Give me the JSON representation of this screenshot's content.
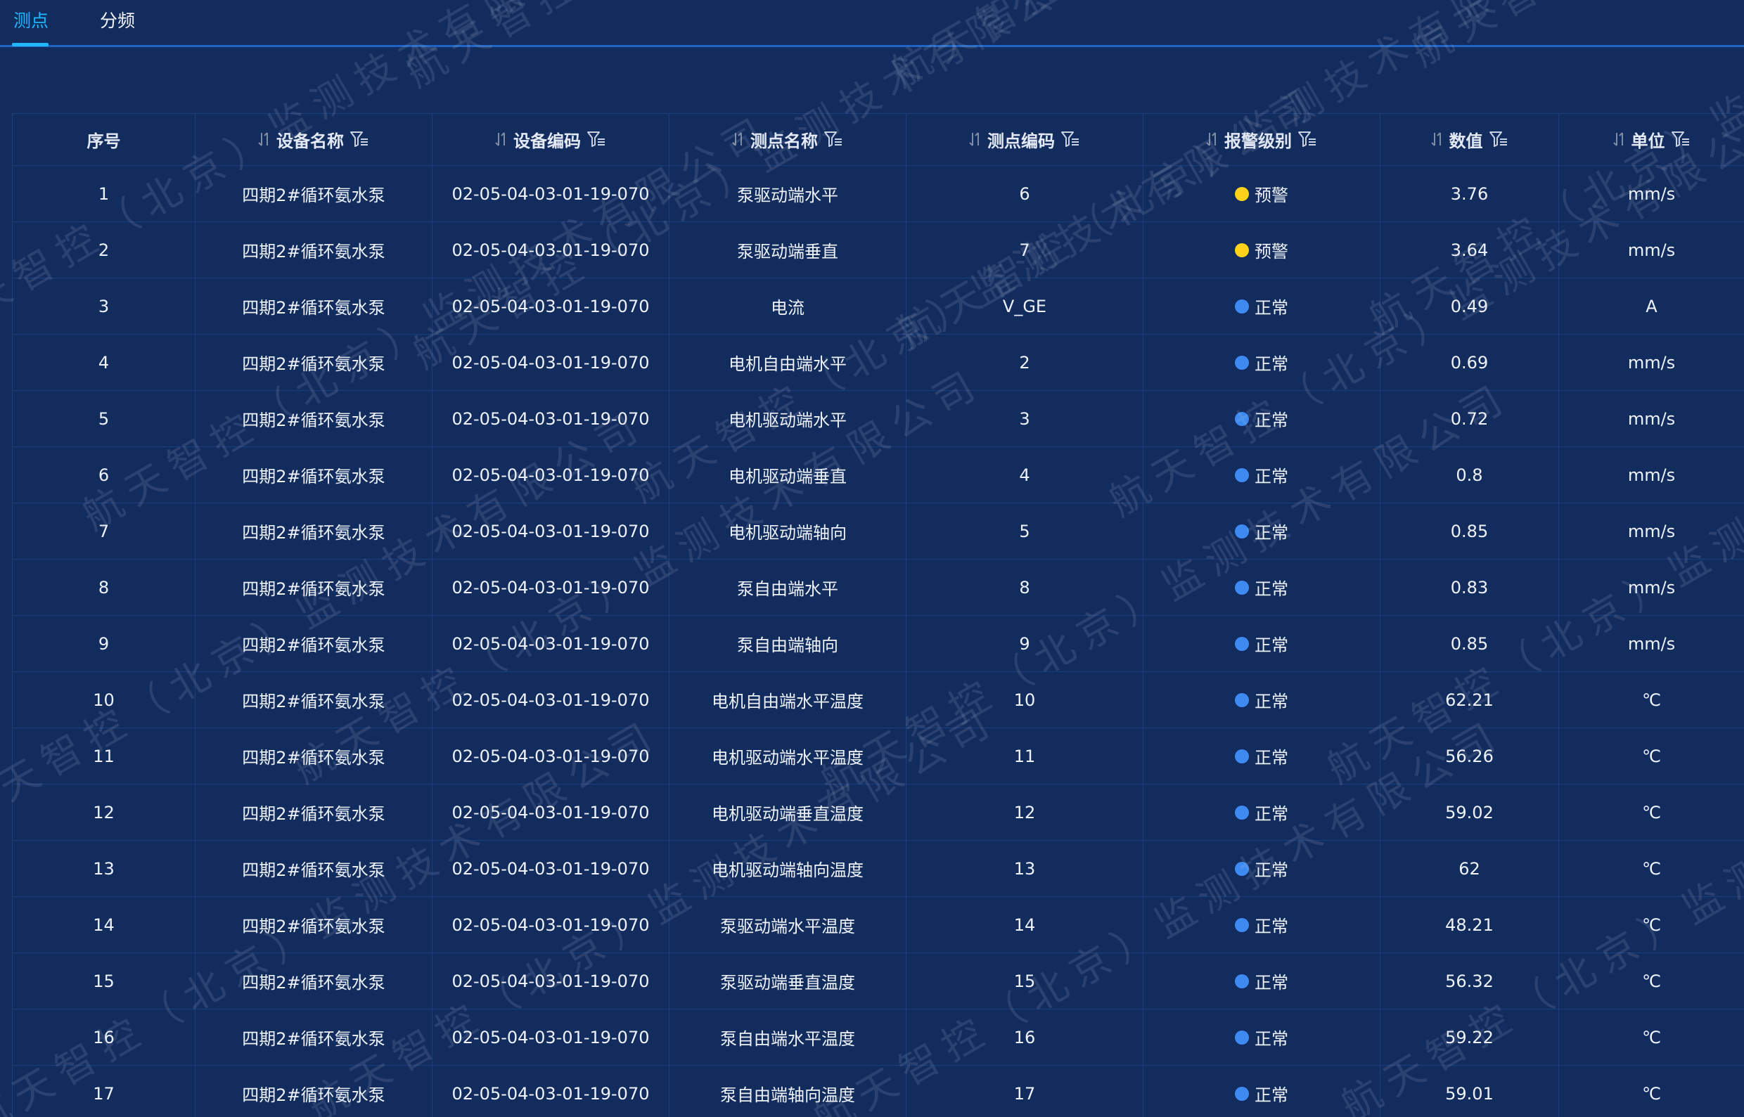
{
  "tabs": [
    {
      "label": "测点",
      "active": true
    },
    {
      "label": "分频",
      "active": false
    }
  ],
  "table": {
    "columns": [
      {
        "label": "序号",
        "sortable": false,
        "filterable": false
      },
      {
        "label": "设备名称",
        "sortable": true,
        "filterable": true
      },
      {
        "label": "设备编码",
        "sortable": true,
        "filterable": true
      },
      {
        "label": "测点名称",
        "sortable": true,
        "filterable": true
      },
      {
        "label": "测点编码",
        "sortable": true,
        "filterable": true
      },
      {
        "label": "报警级别",
        "sortable": true,
        "filterable": true
      },
      {
        "label": "数值",
        "sortable": true,
        "filterable": true
      },
      {
        "label": "单位",
        "sortable": true,
        "filterable": true
      }
    ],
    "rows": [
      {
        "idx": "1",
        "device": "四期2#循环氨水泵",
        "code": "02-05-04-03-01-19-070",
        "point": "泵驱动端水平",
        "point_code": "6",
        "alarm": "预警",
        "alarm_level": "warn",
        "value": "3.76",
        "unit": "mm/s"
      },
      {
        "idx": "2",
        "device": "四期2#循环氨水泵",
        "code": "02-05-04-03-01-19-070",
        "point": "泵驱动端垂直",
        "point_code": "7",
        "alarm": "预警",
        "alarm_level": "warn",
        "value": "3.64",
        "unit": "mm/s"
      },
      {
        "idx": "3",
        "device": "四期2#循环氨水泵",
        "code": "02-05-04-03-01-19-070",
        "point": "电流",
        "point_code": "V_GE",
        "alarm": "正常",
        "alarm_level": "normal",
        "value": "0.49",
        "unit": "A"
      },
      {
        "idx": "4",
        "device": "四期2#循环氨水泵",
        "code": "02-05-04-03-01-19-070",
        "point": "电机自由端水平",
        "point_code": "2",
        "alarm": "正常",
        "alarm_level": "normal",
        "value": "0.69",
        "unit": "mm/s"
      },
      {
        "idx": "5",
        "device": "四期2#循环氨水泵",
        "code": "02-05-04-03-01-19-070",
        "point": "电机驱动端水平",
        "point_code": "3",
        "alarm": "正常",
        "alarm_level": "normal",
        "value": "0.72",
        "unit": "mm/s"
      },
      {
        "idx": "6",
        "device": "四期2#循环氨水泵",
        "code": "02-05-04-03-01-19-070",
        "point": "电机驱动端垂直",
        "point_code": "4",
        "alarm": "正常",
        "alarm_level": "normal",
        "value": "0.8",
        "unit": "mm/s"
      },
      {
        "idx": "7",
        "device": "四期2#循环氨水泵",
        "code": "02-05-04-03-01-19-070",
        "point": "电机驱动端轴向",
        "point_code": "5",
        "alarm": "正常",
        "alarm_level": "normal",
        "value": "0.85",
        "unit": "mm/s"
      },
      {
        "idx": "8",
        "device": "四期2#循环氨水泵",
        "code": "02-05-04-03-01-19-070",
        "point": "泵自由端水平",
        "point_code": "8",
        "alarm": "正常",
        "alarm_level": "normal",
        "value": "0.83",
        "unit": "mm/s"
      },
      {
        "idx": "9",
        "device": "四期2#循环氨水泵",
        "code": "02-05-04-03-01-19-070",
        "point": "泵自由端轴向",
        "point_code": "9",
        "alarm": "正常",
        "alarm_level": "normal",
        "value": "0.85",
        "unit": "mm/s"
      },
      {
        "idx": "10",
        "device": "四期2#循环氨水泵",
        "code": "02-05-04-03-01-19-070",
        "point": "电机自由端水平温度",
        "point_code": "10",
        "alarm": "正常",
        "alarm_level": "normal",
        "value": "62.21",
        "unit": "℃"
      },
      {
        "idx": "11",
        "device": "四期2#循环氨水泵",
        "code": "02-05-04-03-01-19-070",
        "point": "电机驱动端水平温度",
        "point_code": "11",
        "alarm": "正常",
        "alarm_level": "normal",
        "value": "56.26",
        "unit": "℃"
      },
      {
        "idx": "12",
        "device": "四期2#循环氨水泵",
        "code": "02-05-04-03-01-19-070",
        "point": "电机驱动端垂直温度",
        "point_code": "12",
        "alarm": "正常",
        "alarm_level": "normal",
        "value": "59.02",
        "unit": "℃"
      },
      {
        "idx": "13",
        "device": "四期2#循环氨水泵",
        "code": "02-05-04-03-01-19-070",
        "point": "电机驱动端轴向温度",
        "point_code": "13",
        "alarm": "正常",
        "alarm_level": "normal",
        "value": "62",
        "unit": "℃"
      },
      {
        "idx": "14",
        "device": "四期2#循环氨水泵",
        "code": "02-05-04-03-01-19-070",
        "point": "泵驱动端水平温度",
        "point_code": "14",
        "alarm": "正常",
        "alarm_level": "normal",
        "value": "48.21",
        "unit": "℃"
      },
      {
        "idx": "15",
        "device": "四期2#循环氨水泵",
        "code": "02-05-04-03-01-19-070",
        "point": "泵驱动端垂直温度",
        "point_code": "15",
        "alarm": "正常",
        "alarm_level": "normal",
        "value": "56.32",
        "unit": "℃"
      },
      {
        "idx": "16",
        "device": "四期2#循环氨水泵",
        "code": "02-05-04-03-01-19-070",
        "point": "泵自由端水平温度",
        "point_code": "16",
        "alarm": "正常",
        "alarm_level": "normal",
        "value": "59.22",
        "unit": "℃"
      },
      {
        "idx": "17",
        "device": "四期2#循环氨水泵",
        "code": "02-05-04-03-01-19-070",
        "point": "泵自由端轴向温度",
        "point_code": "17",
        "alarm": "正常",
        "alarm_level": "normal",
        "value": "59.01",
        "unit": "℃"
      }
    ]
  },
  "status_colors": {
    "warn": "#ffd21a",
    "normal": "#3d8bf2"
  },
  "icons": {
    "sort": "sort-arrows-icon",
    "filter": "filter-icon"
  },
  "watermark": {
    "text": "航天智控（北京）监测技术有限公司"
  }
}
